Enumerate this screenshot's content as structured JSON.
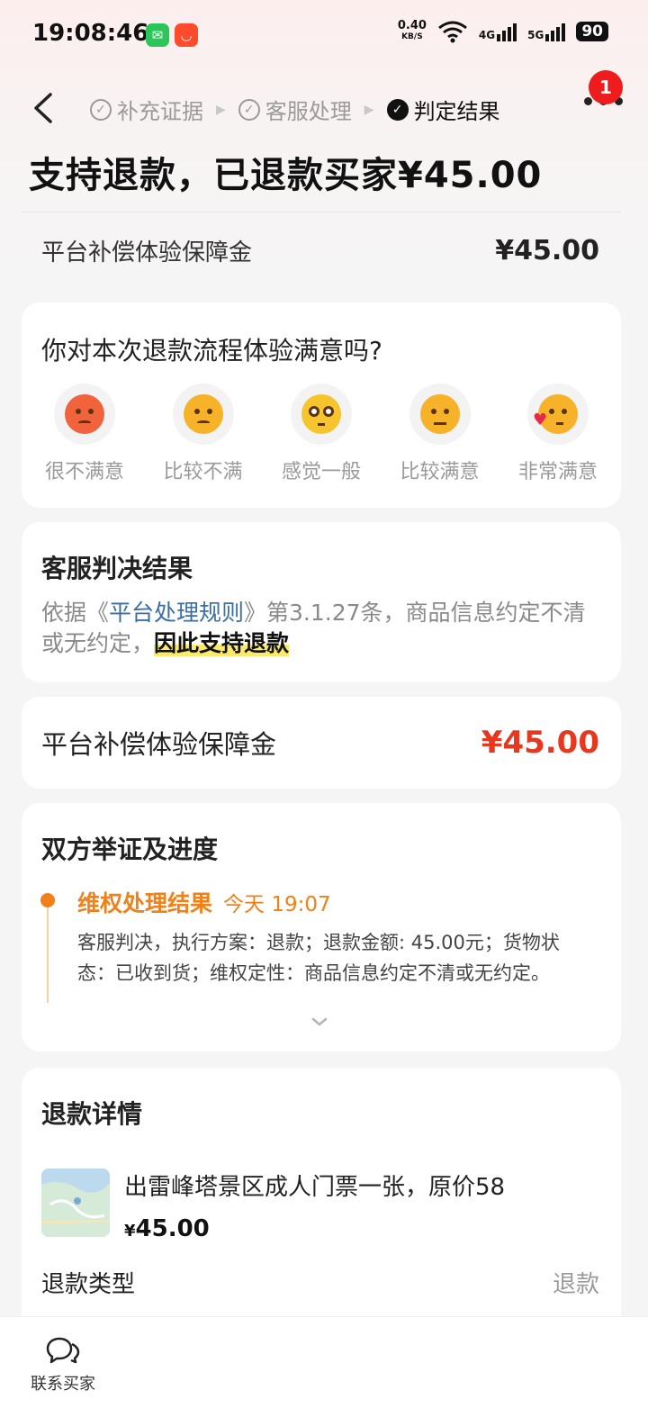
{
  "status_bar": {
    "time": "19:08:46",
    "speed_value": "0.40",
    "speed_unit": "KB/S",
    "network_4g": "4G",
    "network_5g": "5G",
    "battery": "90"
  },
  "nav": {
    "steps": [
      {
        "label": "补充证据",
        "state": "done"
      },
      {
        "label": "客服处理",
        "state": "done"
      },
      {
        "label": "判定结果",
        "state": "active"
      }
    ],
    "badge_count": "1"
  },
  "header": {
    "title": "支持退款，已退款买家¥45.00",
    "compensation_label": "平台补偿体验保障金",
    "compensation_value": "¥45.00"
  },
  "satisfaction": {
    "question": "你对本次退款流程体验满意吗?",
    "options": [
      "很不满意",
      "比较不满",
      "感觉一般",
      "比较满意",
      "非常满意"
    ]
  },
  "verdict": {
    "title": "客服判决结果",
    "text_prefix": "依据《",
    "rule_link": "平台处理规则",
    "text_middle": "》第3.1.27条，商品信息约定不清或无约定，",
    "highlight": "因此支持退款"
  },
  "compensation_card": {
    "label": "平台补偿体验保障金",
    "value": "¥45.00"
  },
  "progress": {
    "title": "双方举证及进度",
    "event_title": "维权处理结果",
    "event_time": "今天 19:07",
    "event_desc": "客服判决，执行方案：退款；退款金额: 45.00元；货物状态：已收到货；维权定性：商品信息约定不清或无约定。"
  },
  "refund_detail": {
    "title": "退款详情",
    "product_name": "出雷峰塔景区成人门票一张，原价58",
    "currency": "¥",
    "price": "45.00",
    "refund_type_label": "退款类型",
    "refund_type_value": "退款"
  },
  "bottom": {
    "contact_label": "联系买家"
  },
  "colors": {
    "accent_red": "#e8371f",
    "timeline_orange": "#f0811a",
    "link_blue": "#3a6ea5",
    "badge_red": "#ee1c1c"
  }
}
